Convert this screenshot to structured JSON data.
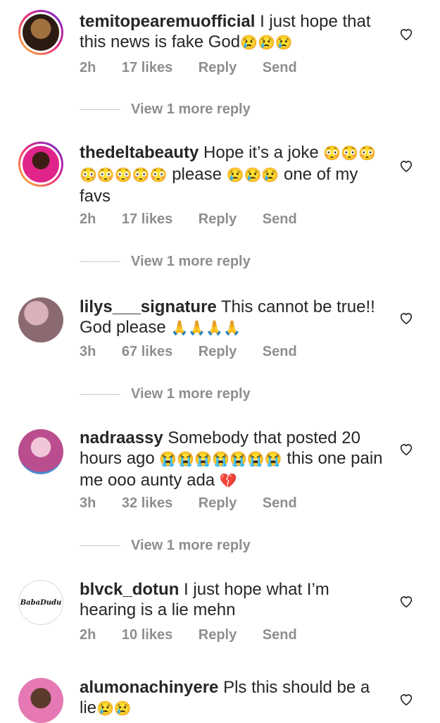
{
  "comments": [
    {
      "username": "temitopearemuofficial",
      "text": "I just hope that this news is fake God",
      "emoji": "😢😢😢",
      "age": "2h",
      "likes": "17 likes",
      "reply": "Reply",
      "send": "Send",
      "view_more": "View 1 more reply"
    },
    {
      "username": "thedeltabeauty",
      "text_a": "Hope it’s a joke",
      "emoji_a": "😳😳😳",
      "emoji_b": "😳😳😳😳😳",
      "text_b": "please",
      "emoji_c": "😢😢😢",
      "text_c": "one of my favs",
      "age": "2h",
      "likes": "17 likes",
      "reply": "Reply",
      "send": "Send",
      "view_more": "View 1 more reply"
    },
    {
      "username": "lilys___signature",
      "text": "This cannot be true!! God please",
      "emoji": "🙏🙏🙏🙏",
      "age": "3h",
      "likes": "67 likes",
      "reply": "Reply",
      "send": "Send",
      "view_more": "View 1 more reply"
    },
    {
      "username": "nadraassy",
      "text_a": "Somebody that posted 20 hours ago",
      "emoji_a": "😭😭😭😭😭😭😭",
      "text_b": "this one pain me ooo aunty ada",
      "emoji_b": "💔",
      "age": "3h",
      "likes": "32 likes",
      "reply": "Reply",
      "send": "Send",
      "view_more": "View 1 more reply"
    },
    {
      "username": "blvck_dotun",
      "text": "I just hope what I’m hearing is a lie mehn",
      "avatar_text": "BabaDudu",
      "age": "2h",
      "likes": "10 likes",
      "reply": "Reply",
      "send": "Send"
    },
    {
      "username": "alumonachinyere",
      "text": "Pls this should be a lie",
      "emoji": "😢😢"
    }
  ],
  "colors": {
    "text": "#262626",
    "muted": "#8e8e8e",
    "ring_start": "#f9ce34",
    "ring_end": "#6228d7"
  }
}
